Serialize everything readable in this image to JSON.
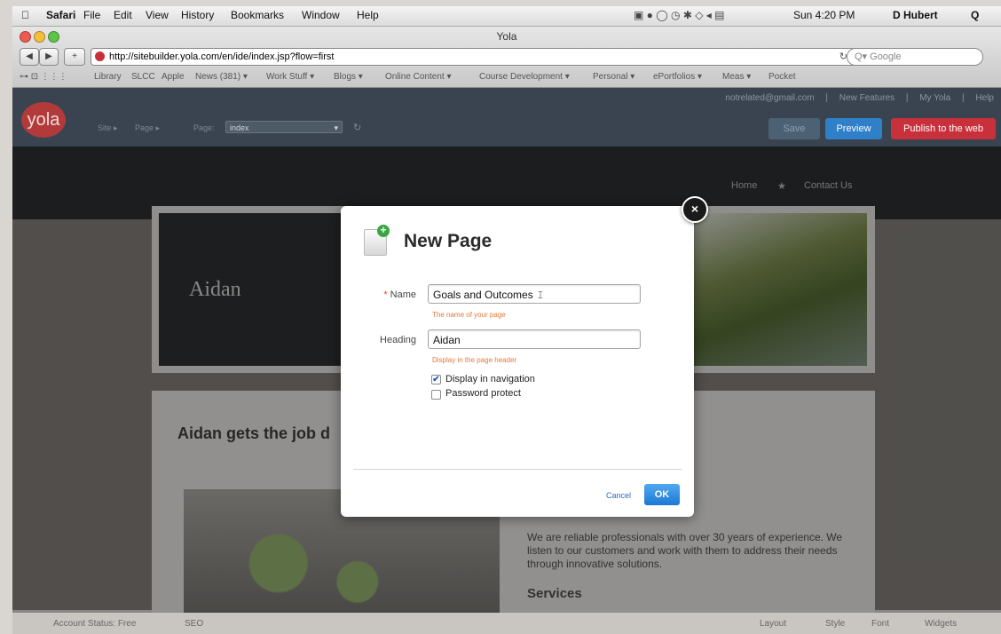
{
  "menubar": {
    "apple": "",
    "items": [
      "Safari",
      "File",
      "Edit",
      "View",
      "History",
      "Bookmarks",
      "Window",
      "Help"
    ],
    "clock": "Sun 4:20 PM",
    "user": "D Hubert",
    "spotlight": "Q"
  },
  "window": {
    "title": "Yola",
    "back": "◀",
    "forward": "▶",
    "add": "+",
    "url": "http://sitebuilder.yola.com/en/ide/index.jsp?flow=first",
    "reload": "↻",
    "search_placeholder": "Q▾ Google"
  },
  "bookmarks": [
    "Library",
    "SLCC",
    "Apple",
    "News (381) ▾",
    "Work Stuff ▾",
    "Blogs ▾",
    "Online Content ▾",
    "Course Development ▾",
    "Personal ▾",
    "ePortfolios ▾",
    "Meas ▾",
    "Pocket"
  ],
  "yola": {
    "logo": "yola",
    "account_email": "notrelated@gmail.com",
    "new_features": "New Features",
    "my_yola": "My Yola",
    "help": "Help",
    "site_crumb": "Site ▸",
    "page_crumb": "Page ▸",
    "page_label": "Page:",
    "page_select": "index",
    "save": "Save",
    "preview": "Preview",
    "publish": "Publish to the web"
  },
  "site": {
    "nav": [
      "Home",
      "★",
      "Contact Us"
    ],
    "banner_name": "Aidan",
    "content_title": "Aidan gets the job d",
    "description": "We are reliable professionals with over 30 years of experience. We listen to our customers and work with them to address their needs through innovative solutions.",
    "services_heading": "Services"
  },
  "bottombar": {
    "account_status": "Account Status: Free",
    "seo": "SEO",
    "layout": "Layout",
    "style": "Style",
    "font": "Font",
    "widgets": "Widgets"
  },
  "dialog": {
    "title": "New Page",
    "close": "×",
    "name_label": "Name",
    "required_mark": "*",
    "name_value": "Goals and Outcomes",
    "name_hint": "The name of your page",
    "heading_label": "Heading",
    "heading_value": "Aidan",
    "heading_hint": "Display in the page header",
    "display_nav_label": "Display in navigation",
    "display_nav_checked": true,
    "password_label": "Password protect",
    "password_checked": false,
    "cancel": "Cancel",
    "ok": "OK"
  },
  "colors": {
    "yola_red": "#b23a3a",
    "preview_blue": "#2f7fc9",
    "publish_red": "#c8313b",
    "hint_orange": "#e07a3a",
    "ok_blue": "#1d78d4"
  }
}
